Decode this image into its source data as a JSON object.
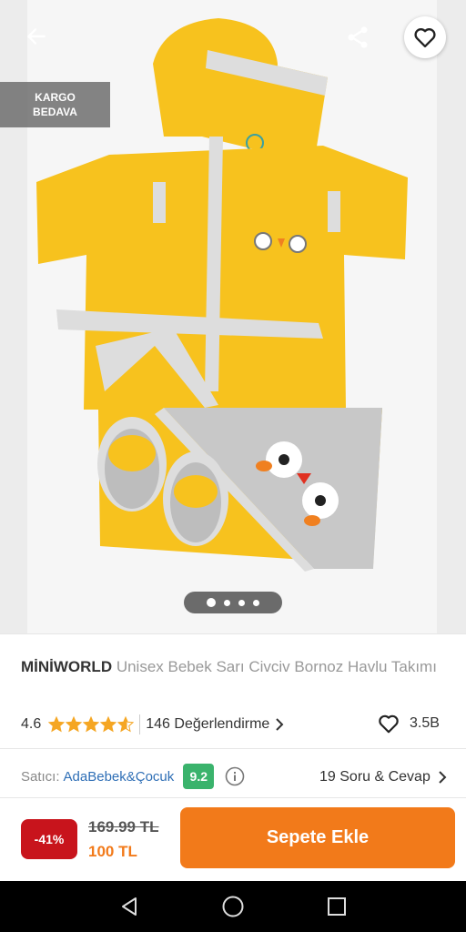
{
  "hero": {
    "cargo_badge": {
      "line1": "KARGO",
      "line2": "BEDAVA"
    },
    "carousel": {
      "count": 4,
      "active_index": 0
    },
    "icons": {
      "back": "arrow-left-icon",
      "share": "share-icon",
      "favorite": "heart-icon"
    }
  },
  "product": {
    "brand": "MİNİWORLD",
    "name": "Unisex Bebek Sarı Civciv Bornoz Havlu Takımı",
    "rating_value": "4.6",
    "rating_stars": 4.6,
    "reviews_label": "146 Değerlendirme",
    "favorites_count": "3.5B"
  },
  "seller": {
    "label": "Satıcı:",
    "name": "AdaBebek&Çocuk",
    "score": "9.2",
    "qa_label": "19 Soru & Cevap"
  },
  "purchase": {
    "discount": "-41%",
    "old_price": "169.99 TL",
    "new_price": "100 TL",
    "cart_label": "Sepete Ekle"
  },
  "colors": {
    "accent": "#f27a1a",
    "discount_bg": "#c8141c",
    "score_bg": "#3ab36c",
    "seller_link": "#2f6fb6",
    "star": "#f5a623"
  }
}
